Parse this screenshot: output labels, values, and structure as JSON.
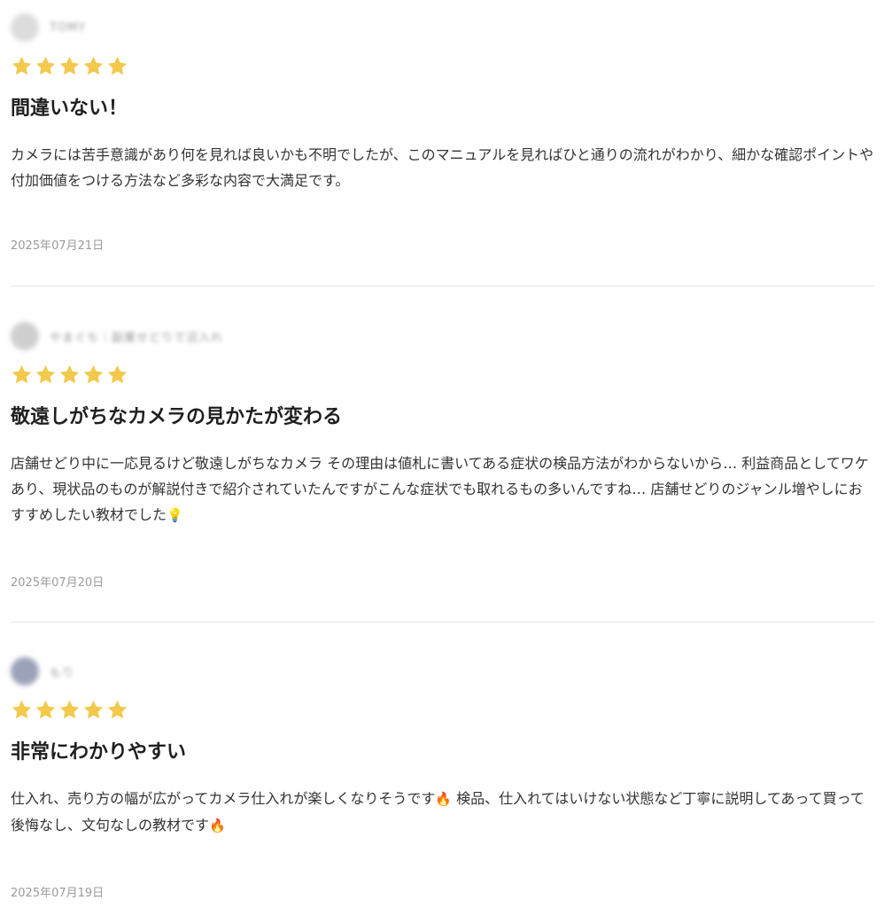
{
  "reviews": [
    {
      "reviewer": "TOMY",
      "rating": 5,
      "title": "間違いない！",
      "body": "カメラには苦手意識があり何を見れば良いかも不明でしたが、このマニュアルを見ればひと通りの流れがわかり、細かな確認ポイントや付加価値をつける方法など多彩な内容で大満足です。",
      "emoji": "",
      "date": "2025年07月21日"
    },
    {
      "reviewer": "やまぐち｜副業せどりで沼入れ",
      "rating": 5,
      "title": "敬遠しがちなカメラの見かたが変わる",
      "body": "店舗せどり中に一応見るけど敬遠しがちなカメラ その理由は値札に書いてある症状の検品方法がわからないから… 利益商品としてワケあり、現状品のものが解説付きで紹介されていたんですがこんな症状でも取れるもの多いんですね… 店舗せどりのジャンル増やしにおすすめしたい教材でした",
      "emoji": "💡",
      "date": "2025年07月20日"
    },
    {
      "reviewer": "もり",
      "rating": 5,
      "title": "非常にわかりやすい",
      "body_part1": "仕入れ、売り方の幅が広がってカメラ仕入れが楽しくなりそうです",
      "emoji1": "🔥",
      "body_part2": " 検品、仕入れてはいけない状態など丁寧に説明してあって買って後悔なし、文句なしの教材です",
      "emoji2": "🔥",
      "date": "2025年07月19日"
    }
  ],
  "colors": {
    "star": "#F2C94C",
    "divider": "#E3E3E3",
    "date": "#9B9B9B"
  },
  "icons": {
    "star": "star-icon"
  }
}
